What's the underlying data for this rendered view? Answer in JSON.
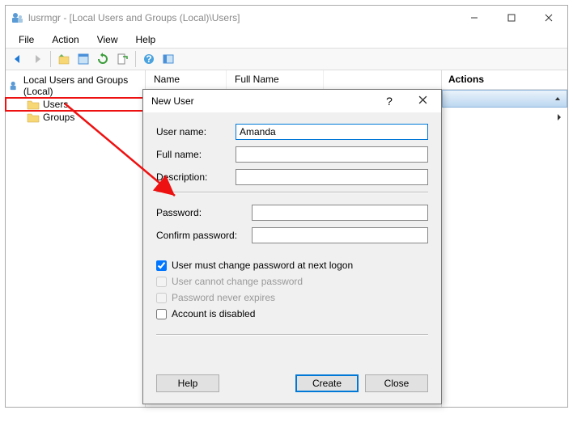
{
  "window": {
    "title": "lusrmgr - [Local Users and Groups (Local)\\Users]"
  },
  "menubar": [
    "File",
    "Action",
    "View",
    "Help"
  ],
  "tree": {
    "root": "Local Users and Groups (Local)",
    "items": [
      {
        "label": "Users",
        "selected": true
      },
      {
        "label": "Groups",
        "selected": false
      }
    ]
  },
  "center": {
    "columns": [
      "Name",
      "Full Name"
    ]
  },
  "actions": {
    "header": "Actions"
  },
  "dialog": {
    "title": "New User",
    "fields": {
      "username_label": "User name:",
      "username_value": "Amanda",
      "fullname_label": "Full name:",
      "fullname_value": "",
      "description_label": "Description:",
      "description_value": "",
      "password_label": "Password:",
      "password_value": "",
      "confirm_label": "Confirm password:",
      "confirm_value": ""
    },
    "checkboxes": {
      "must_change": "User must change password at next logon",
      "cannot_change": "User cannot change password",
      "never_expires": "Password never expires",
      "disabled": "Account is disabled"
    },
    "buttons": {
      "help": "Help",
      "create": "Create",
      "close": "Close"
    }
  }
}
